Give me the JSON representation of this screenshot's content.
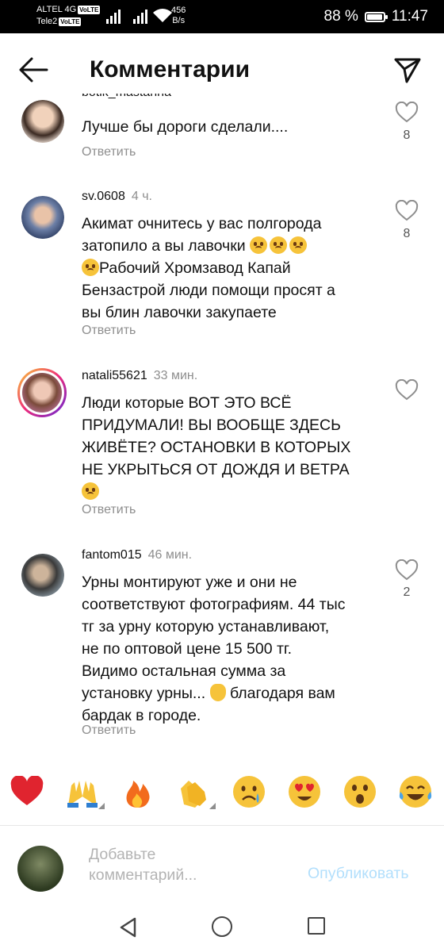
{
  "status_bar": {
    "carrier1": "ALTEL 4G",
    "carrier2": "Tele2",
    "volte": "VoLTE",
    "speed_value": "456",
    "speed_unit": "B/s",
    "battery": "88 %",
    "battery_level": 0.88,
    "time": "11:47"
  },
  "header": {
    "title": "Комментарии"
  },
  "partial_username": "botik_mastanna",
  "comments": [
    {
      "text": "Лучше бы дороги сделали....",
      "likes": "8",
      "reply": "Ответить",
      "avatar_color": "#d9a47c"
    },
    {
      "user": "sv.0608",
      "time": "4 ч.",
      "text_line1": "Акимат очнитесь у вас полгорода",
      "text_line2": "затопило а вы лавочки",
      "text_line3": "Рабочий Хромзавод Капай",
      "text_line4": "Бензастрой люди помощи просят а",
      "text_line5": "вы блин лавочки закупаете",
      "likes": "8",
      "reply": "Ответить",
      "avatar_color": "#5a7fae"
    },
    {
      "user": "natali55621",
      "time": "33 мин.",
      "text_line1": "Люди которые ВОТ ЭТО ВСЁ",
      "text_line2": "ПРИДУМАЛИ! ВЫ ВООБЩЕ ЗДЕСЬ",
      "text_line3": "ЖИВЁТЕ? ОСТАНОВКИ В КОТОРЫХ",
      "text_line4": "НЕ УКРЫТЬСЯ ОТ ДОЖДЯ И ВЕТРА",
      "reply": "Ответить",
      "avatar_color": "#c98a86"
    },
    {
      "user": "fantom015",
      "time": "46 мин.",
      "text_line1": "Урны монтируют уже и они не",
      "text_line2": "соответствуют фотографиям. 44 тыс",
      "text_line3": "тг за урну которую устанавливают,",
      "text_line4": "не по оптовой цене 15 500 тг.",
      "text_line5": "Видимо остальная сумма за",
      "text_line6": "установку урны...",
      "text_line6b": "благодаря вам",
      "text_line7": "бардак в городе.",
      "likes": "2",
      "reply": "Ответить",
      "avatar_color": "#4d4d4d"
    }
  ],
  "emoji_bar": [
    "red-heart",
    "raising-hands",
    "fire",
    "clapping-hands",
    "crying-face",
    "heart-eyes-face",
    "astonished-face",
    "tears-of-joy-face"
  ],
  "comment_input": {
    "placeholder_line1": "Добавьте",
    "placeholder_line2": "комментарий...",
    "publish": "Опубликовать"
  },
  "colors": {
    "accent_disabled": "#b2dffc",
    "secondary_text": "#8e8e8e"
  }
}
